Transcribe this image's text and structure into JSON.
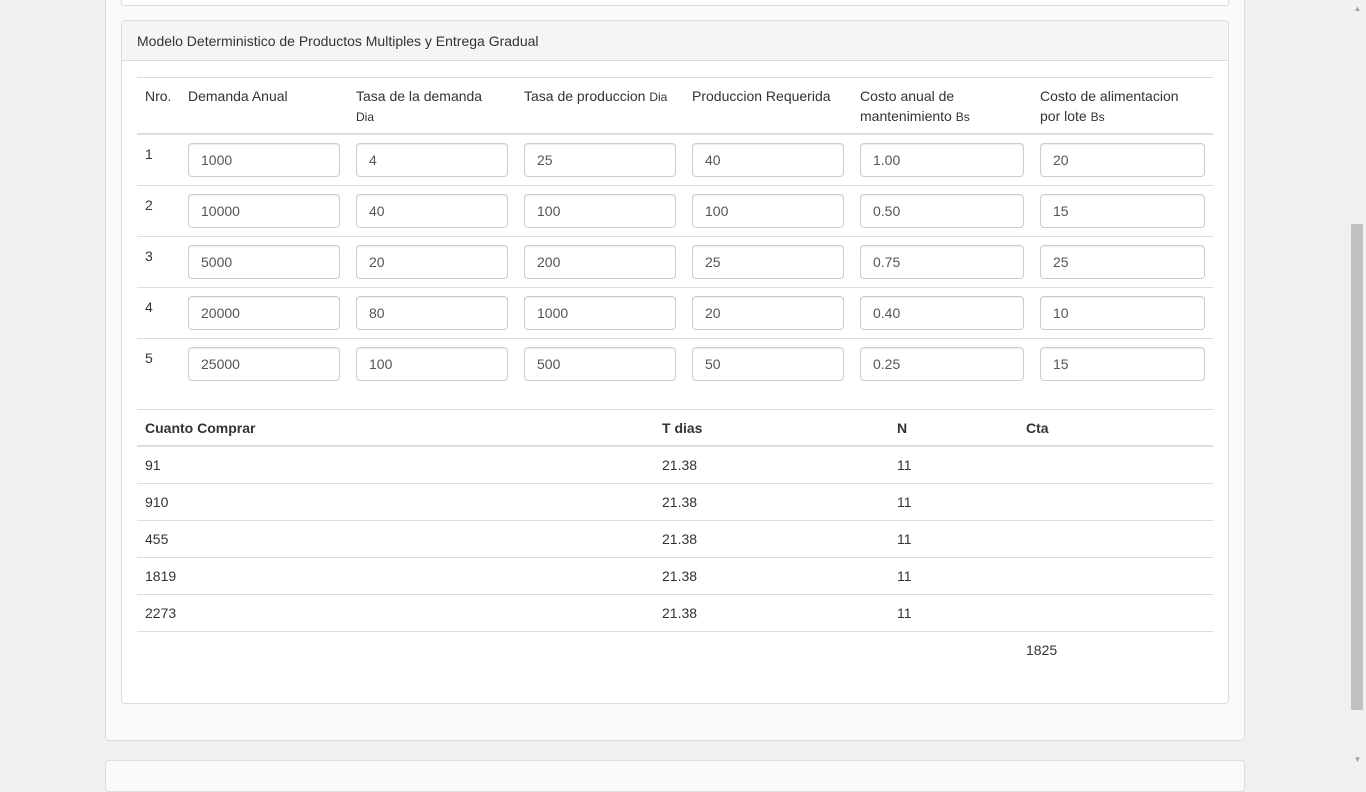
{
  "panel": {
    "title": "Modelo Deterministico de Productos Multiples y Entrega Gradual"
  },
  "input_table": {
    "headers": {
      "nro": "Nro.",
      "demanda": "Demanda Anual",
      "tasa_demanda": "Tasa de la demanda",
      "tasa_demanda_unit": "Dia",
      "tasa_produccion": "Tasa de produccion",
      "tasa_produccion_unit": "Dia",
      "produccion": "Produccion Requerida",
      "costo_mant_1": "Costo anual de",
      "costo_mant_2": "mantenimiento",
      "costo_mant_unit": "Bs",
      "costo_alim_1": "Costo de alimentacion",
      "costo_alim_2": "por lote",
      "costo_alim_unit": "Bs"
    },
    "rows": [
      {
        "nro": "1",
        "demanda": "1000",
        "tasa_demanda": "4",
        "tasa_produccion": "25",
        "produccion": "40",
        "costo_mant": "1.00",
        "costo_alim": "20"
      },
      {
        "nro": "2",
        "demanda": "10000",
        "tasa_demanda": "40",
        "tasa_produccion": "100",
        "produccion": "100",
        "costo_mant": "0.50",
        "costo_alim": "15"
      },
      {
        "nro": "3",
        "demanda": "5000",
        "tasa_demanda": "20",
        "tasa_produccion": "200",
        "produccion": "25",
        "costo_mant": "0.75",
        "costo_alim": "25"
      },
      {
        "nro": "4",
        "demanda": "20000",
        "tasa_demanda": "80",
        "tasa_produccion": "1000",
        "produccion": "20",
        "costo_mant": "0.40",
        "costo_alim": "10"
      },
      {
        "nro": "5",
        "demanda": "25000",
        "tasa_demanda": "100",
        "tasa_produccion": "500",
        "produccion": "50",
        "costo_mant": "0.25",
        "costo_alim": "15"
      }
    ]
  },
  "results_table": {
    "headers": {
      "cuanto": "Cuanto Comprar",
      "t": "T dias",
      "n": "N",
      "cta": "Cta"
    },
    "rows": [
      {
        "cuanto": "91",
        "t": "21.38",
        "n": "11"
      },
      {
        "cuanto": "910",
        "t": "21.38",
        "n": "11"
      },
      {
        "cuanto": "455",
        "t": "21.38",
        "n": "11"
      },
      {
        "cuanto": "1819",
        "t": "21.38",
        "n": "11"
      },
      {
        "cuanto": "2273",
        "t": "21.38",
        "n": "11"
      }
    ],
    "total_cta": "1825"
  }
}
